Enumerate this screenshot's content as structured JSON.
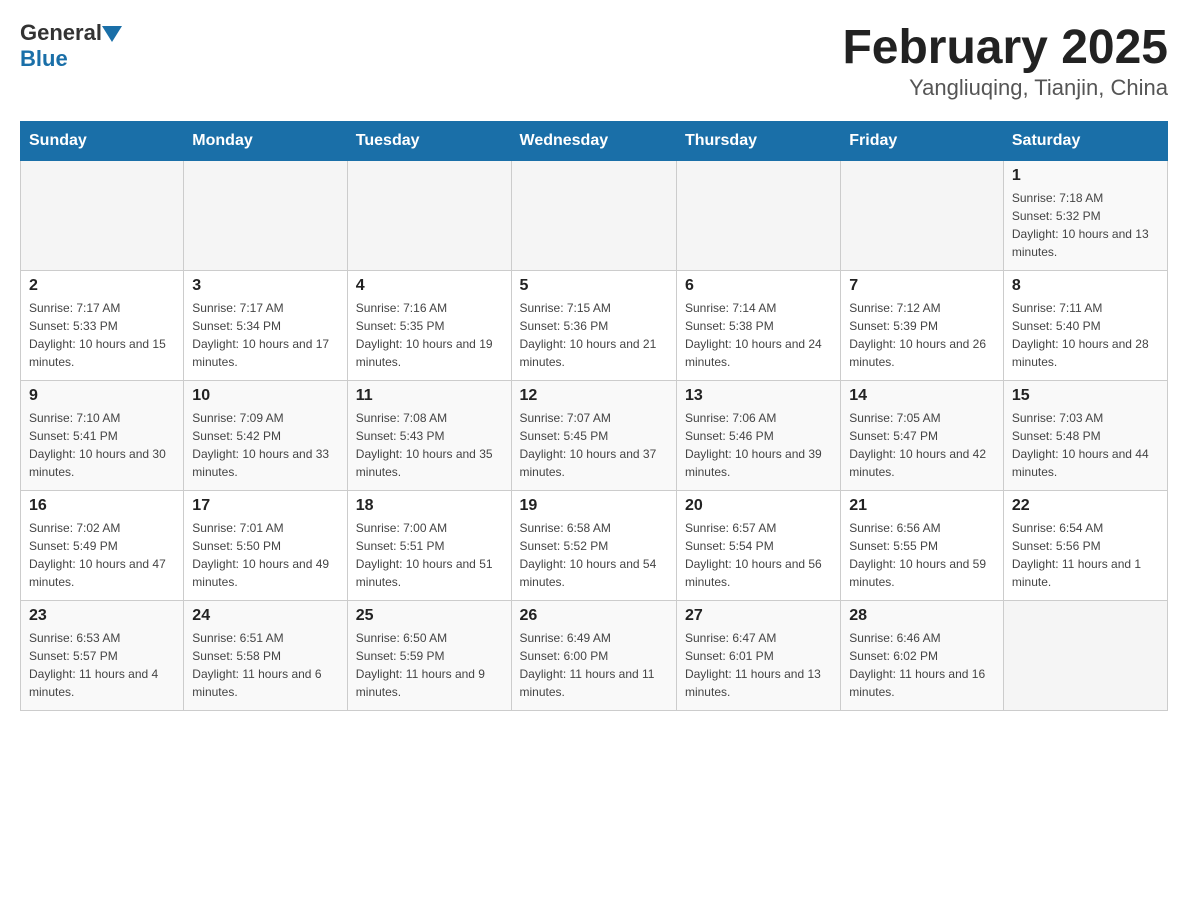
{
  "header": {
    "logo_general": "General",
    "logo_blue": "Blue",
    "month_title": "February 2025",
    "location": "Yangliuqing, Tianjin, China"
  },
  "days_of_week": [
    "Sunday",
    "Monday",
    "Tuesday",
    "Wednesday",
    "Thursday",
    "Friday",
    "Saturday"
  ],
  "weeks": [
    {
      "cells": [
        {
          "day": "",
          "info": ""
        },
        {
          "day": "",
          "info": ""
        },
        {
          "day": "",
          "info": ""
        },
        {
          "day": "",
          "info": ""
        },
        {
          "day": "",
          "info": ""
        },
        {
          "day": "",
          "info": ""
        },
        {
          "day": "1",
          "info": "Sunrise: 7:18 AM\nSunset: 5:32 PM\nDaylight: 10 hours and 13 minutes."
        }
      ]
    },
    {
      "cells": [
        {
          "day": "2",
          "info": "Sunrise: 7:17 AM\nSunset: 5:33 PM\nDaylight: 10 hours and 15 minutes."
        },
        {
          "day": "3",
          "info": "Sunrise: 7:17 AM\nSunset: 5:34 PM\nDaylight: 10 hours and 17 minutes."
        },
        {
          "day": "4",
          "info": "Sunrise: 7:16 AM\nSunset: 5:35 PM\nDaylight: 10 hours and 19 minutes."
        },
        {
          "day": "5",
          "info": "Sunrise: 7:15 AM\nSunset: 5:36 PM\nDaylight: 10 hours and 21 minutes."
        },
        {
          "day": "6",
          "info": "Sunrise: 7:14 AM\nSunset: 5:38 PM\nDaylight: 10 hours and 24 minutes."
        },
        {
          "day": "7",
          "info": "Sunrise: 7:12 AM\nSunset: 5:39 PM\nDaylight: 10 hours and 26 minutes."
        },
        {
          "day": "8",
          "info": "Sunrise: 7:11 AM\nSunset: 5:40 PM\nDaylight: 10 hours and 28 minutes."
        }
      ]
    },
    {
      "cells": [
        {
          "day": "9",
          "info": "Sunrise: 7:10 AM\nSunset: 5:41 PM\nDaylight: 10 hours and 30 minutes."
        },
        {
          "day": "10",
          "info": "Sunrise: 7:09 AM\nSunset: 5:42 PM\nDaylight: 10 hours and 33 minutes."
        },
        {
          "day": "11",
          "info": "Sunrise: 7:08 AM\nSunset: 5:43 PM\nDaylight: 10 hours and 35 minutes."
        },
        {
          "day": "12",
          "info": "Sunrise: 7:07 AM\nSunset: 5:45 PM\nDaylight: 10 hours and 37 minutes."
        },
        {
          "day": "13",
          "info": "Sunrise: 7:06 AM\nSunset: 5:46 PM\nDaylight: 10 hours and 39 minutes."
        },
        {
          "day": "14",
          "info": "Sunrise: 7:05 AM\nSunset: 5:47 PM\nDaylight: 10 hours and 42 minutes."
        },
        {
          "day": "15",
          "info": "Sunrise: 7:03 AM\nSunset: 5:48 PM\nDaylight: 10 hours and 44 minutes."
        }
      ]
    },
    {
      "cells": [
        {
          "day": "16",
          "info": "Sunrise: 7:02 AM\nSunset: 5:49 PM\nDaylight: 10 hours and 47 minutes."
        },
        {
          "day": "17",
          "info": "Sunrise: 7:01 AM\nSunset: 5:50 PM\nDaylight: 10 hours and 49 minutes."
        },
        {
          "day": "18",
          "info": "Sunrise: 7:00 AM\nSunset: 5:51 PM\nDaylight: 10 hours and 51 minutes."
        },
        {
          "day": "19",
          "info": "Sunrise: 6:58 AM\nSunset: 5:52 PM\nDaylight: 10 hours and 54 minutes."
        },
        {
          "day": "20",
          "info": "Sunrise: 6:57 AM\nSunset: 5:54 PM\nDaylight: 10 hours and 56 minutes."
        },
        {
          "day": "21",
          "info": "Sunrise: 6:56 AM\nSunset: 5:55 PM\nDaylight: 10 hours and 59 minutes."
        },
        {
          "day": "22",
          "info": "Sunrise: 6:54 AM\nSunset: 5:56 PM\nDaylight: 11 hours and 1 minute."
        }
      ]
    },
    {
      "cells": [
        {
          "day": "23",
          "info": "Sunrise: 6:53 AM\nSunset: 5:57 PM\nDaylight: 11 hours and 4 minutes."
        },
        {
          "day": "24",
          "info": "Sunrise: 6:51 AM\nSunset: 5:58 PM\nDaylight: 11 hours and 6 minutes."
        },
        {
          "day": "25",
          "info": "Sunrise: 6:50 AM\nSunset: 5:59 PM\nDaylight: 11 hours and 9 minutes."
        },
        {
          "day": "26",
          "info": "Sunrise: 6:49 AM\nSunset: 6:00 PM\nDaylight: 11 hours and 11 minutes."
        },
        {
          "day": "27",
          "info": "Sunrise: 6:47 AM\nSunset: 6:01 PM\nDaylight: 11 hours and 13 minutes."
        },
        {
          "day": "28",
          "info": "Sunrise: 6:46 AM\nSunset: 6:02 PM\nDaylight: 11 hours and 16 minutes."
        },
        {
          "day": "",
          "info": ""
        }
      ]
    }
  ]
}
